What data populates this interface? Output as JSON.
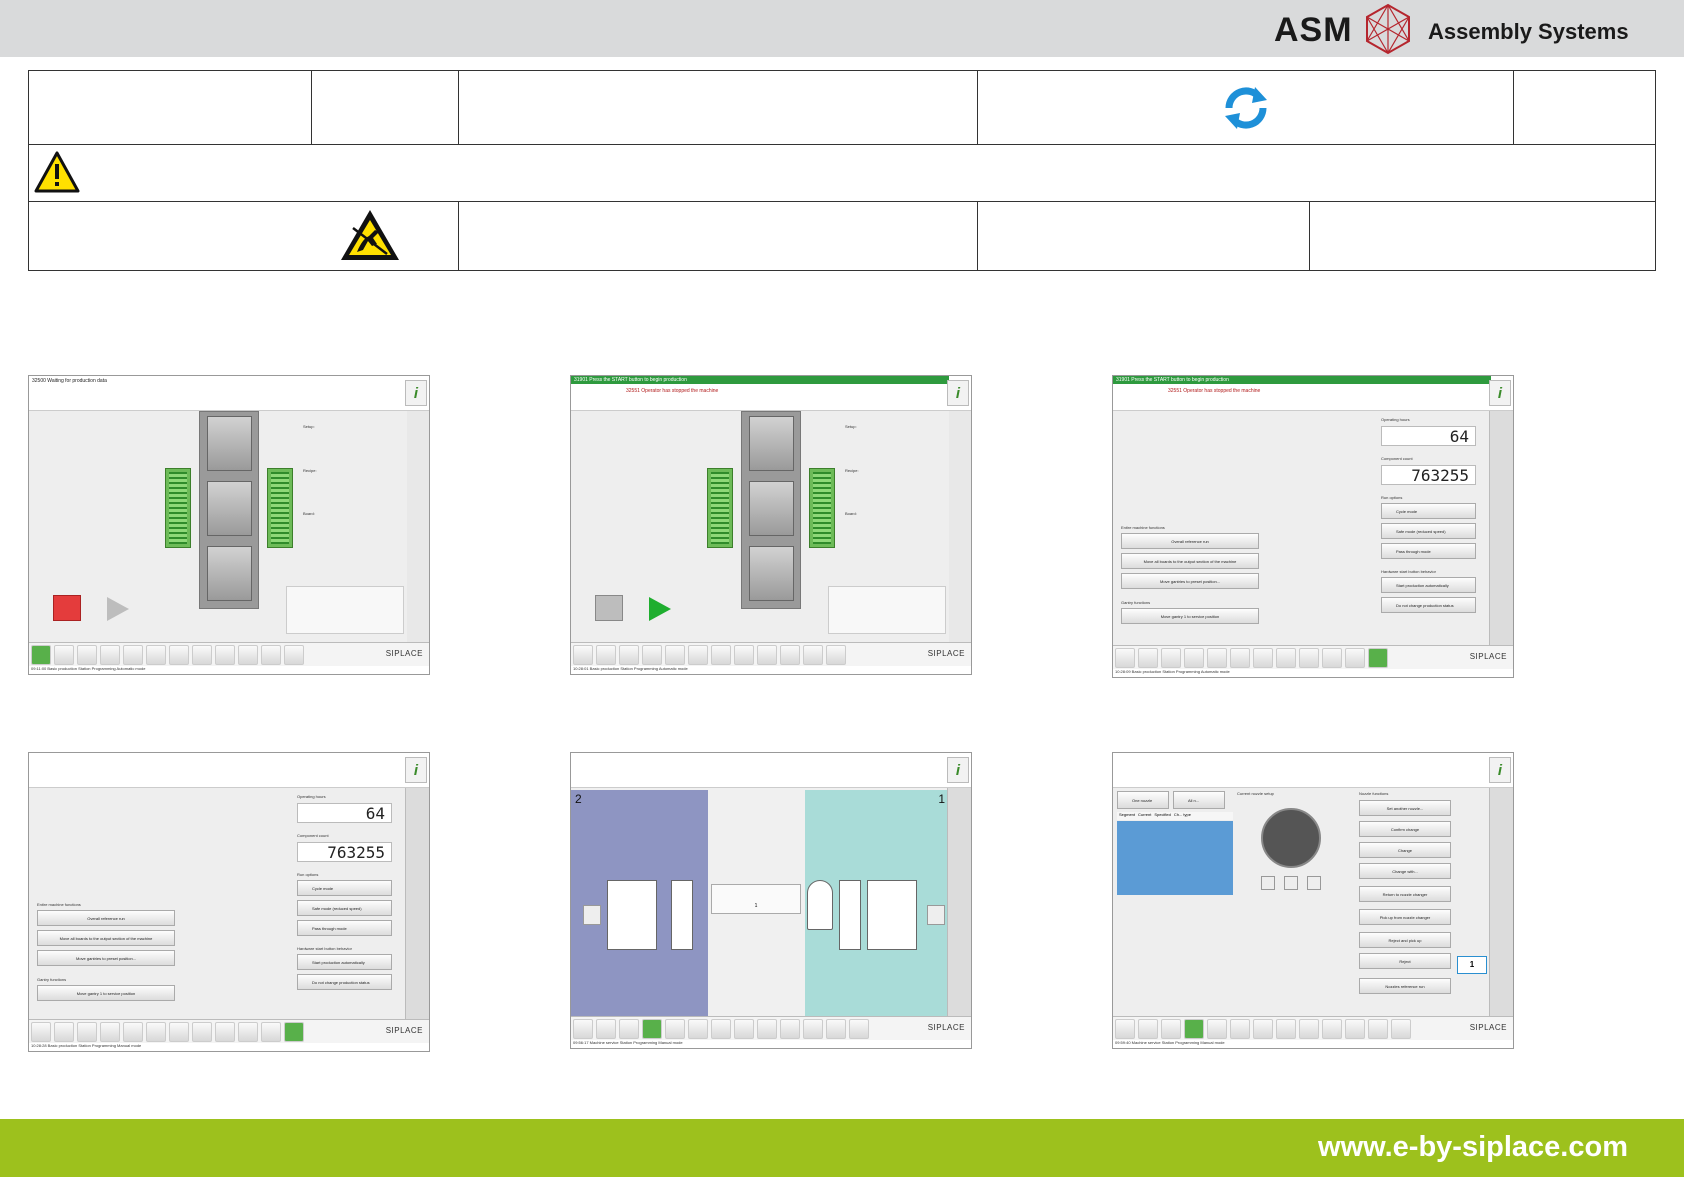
{
  "header": {
    "brand_mark": "ASM",
    "brand_sub": "Assembly Systems",
    "background_color": "#d9dadb"
  },
  "icons": {
    "refresh": "refresh-icon",
    "warning": "warning-icon",
    "esd": "esd-warning-icon"
  },
  "footer": {
    "url": "www.e-by-siplace.com",
    "background_color": "#9dc11d"
  },
  "shots": [
    {
      "msg1": "32500 Waiting for production data",
      "msg2": "",
      "labels": {
        "setup": "Setup:",
        "recipe": "Recipe:",
        "board": "Board:"
      },
      "brand": "SIPLACE",
      "status": "09:11:00        Basic production        Station Programming        Automatic mode"
    },
    {
      "msg1": "31901 Press the START button to begin production",
      "msg2": "32551 Operator has stopped the machine",
      "labels": {
        "setup": "Setup:",
        "recipe": "Recipe:",
        "board": "Board:"
      },
      "brand": "SIPLACE",
      "status": "10:28:01        Basic production        Station Programming        Automatic mode"
    },
    {
      "msg1": "31901 Press the START button to begin production",
      "msg2": "32551 Operator has stopped the machine",
      "operating_hours_label": "Operating hours",
      "operating_hours": "64",
      "component_count_label": "Component count",
      "component_count": "763255",
      "run_options": "Run options",
      "cycle_mode": "Cycle mode",
      "safe_mode": "Safe mode (reduced speed)",
      "pass_through": "Pass through mode",
      "hw_behavior": "Hardware start button behavior",
      "start_auto": "Start production automatically",
      "no_change": "Do not change production status",
      "entire_functions": "Entire machine functions",
      "overall_ref": "Overall reference run",
      "move_boards": "Move all boards to the output section of the machine",
      "move_gantries": "Move gantries to preset position...",
      "gantry_functions": "Gantry functions",
      "gantry_service": "Move gantry 1 to service position",
      "brand": "SIPLACE",
      "status": "10:28:09        Basic production        Station Programming        Automatic mode"
    },
    {
      "operating_hours_label": "Operating hours",
      "operating_hours": "64",
      "component_count_label": "Component count",
      "component_count": "763255",
      "run_options": "Run options",
      "cycle_mode": "Cycle mode",
      "safe_mode": "Safe mode (reduced speed)",
      "pass_through": "Pass through mode",
      "hw_behavior": "Hardware start button behavior",
      "start_auto": "Start production automatically",
      "no_change": "Do not change production status",
      "entire_functions": "Entire machine functions",
      "overall_ref": "Overall reference run",
      "move_boards": "Move all boards to the output section of the machine",
      "move_gantries": "Move gantries to preset position...",
      "gantry_functions": "Gantry functions",
      "gantry_service": "Move gantry 1 to service position",
      "brand": "SIPLACE",
      "status": "10:28:28        Basic production        Station Programming        Manual mode"
    },
    {
      "left_num": "2",
      "right_num": "1",
      "center_label": "1",
      "brand": "SIPLACE",
      "status": "09:56:17        Machine service        Station Programming        Manual mode"
    },
    {
      "one_nozzle": "One nozzle",
      "all_nozzles": "All n...",
      "current_setup": "Current nozzle setup",
      "nozzle_functions": "Nozzle functions",
      "cols": [
        "Segment",
        "Current",
        "Specified",
        "Ch... type"
      ],
      "set_another": "Set another nozzle...",
      "confirm_change": "Confirm change",
      "change": "Change",
      "change_with": "Change with...",
      "return_to": "Return to nozzle changer",
      "pick_up": "Pick up from nozzle changer",
      "reject_pick": "Reject and pick up",
      "reject": "Reject",
      "nozzles_ref": "Nozzles reference run",
      "count": "1",
      "brand": "SIPLACE",
      "status": "09:59:40        Machine service        Station Programming        Manual mode"
    }
  ]
}
